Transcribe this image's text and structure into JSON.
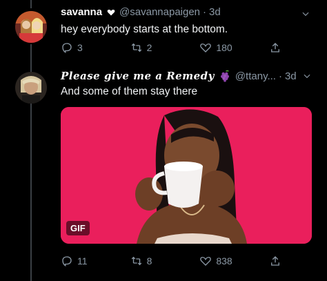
{
  "tweets": [
    {
      "display_name": "savanna",
      "name_icon": "heart-icon",
      "handle": "@savannapaigen",
      "timestamp": "3d",
      "text": "hey everybody starts at the bottom.",
      "replies": "3",
      "retweets": "2",
      "likes": "180"
    },
    {
      "display_name": "Please give me a Remedy",
      "name_icon": "grapes-icon",
      "handle": "@ttany...",
      "timestamp": "3d",
      "text": "And some of them stay there",
      "media_badge": "GIF",
      "replies": "11",
      "retweets": "8",
      "likes": "838"
    }
  ],
  "colors": {
    "background": "#000000",
    "muted": "#8b98a5",
    "media_bg": "#ea1f5c"
  }
}
